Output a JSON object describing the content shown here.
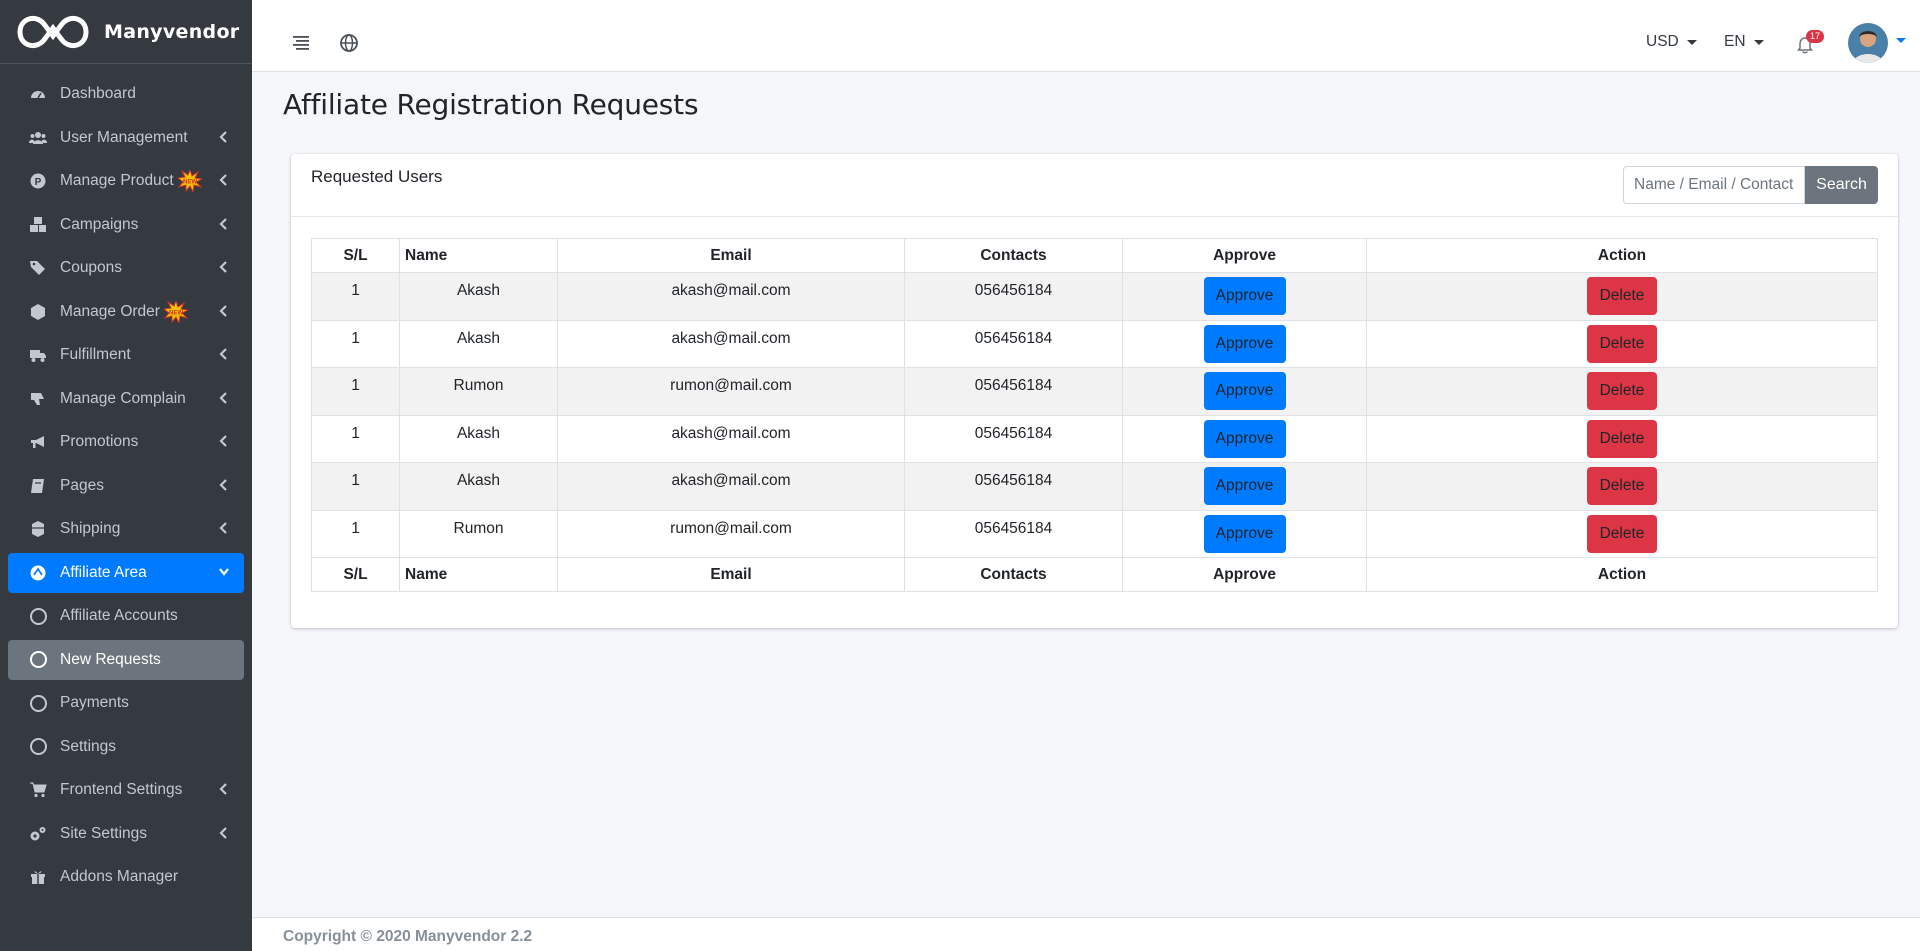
{
  "brand": {
    "name": "Manyvendor"
  },
  "sidebar": {
    "items": [
      {
        "label": "Dashboard",
        "icon": "dashboard-icon",
        "has_chevron": false
      },
      {
        "label": "User Management",
        "icon": "users-icon",
        "has_chevron": true
      },
      {
        "label": "Manage Product",
        "icon": "product-icon",
        "has_chevron": true,
        "new_badge": true
      },
      {
        "label": "Campaigns",
        "icon": "cubes-icon",
        "has_chevron": true
      },
      {
        "label": "Coupons",
        "icon": "tags-icon",
        "has_chevron": true
      },
      {
        "label": "Manage Order",
        "icon": "box-icon",
        "has_chevron": true,
        "new_badge": true
      },
      {
        "label": "Fulfillment",
        "icon": "truck-icon",
        "has_chevron": true
      },
      {
        "label": "Manage Complain",
        "icon": "thumbs-down-icon",
        "has_chevron": true
      },
      {
        "label": "Promotions",
        "icon": "bullhorn-icon",
        "has_chevron": true
      },
      {
        "label": "Pages",
        "icon": "book-icon",
        "has_chevron": true
      },
      {
        "label": "Shipping",
        "icon": "shipping-icon",
        "has_chevron": true
      },
      {
        "label": "Affiliate Area",
        "icon": "affiliate-icon",
        "has_chevron": true,
        "active": true
      },
      {
        "label": "Affiliate Accounts",
        "icon": "circle-icon",
        "sub": true
      },
      {
        "label": "New Requests",
        "icon": "circle-icon",
        "sub": true,
        "selected": true
      },
      {
        "label": "Payments",
        "icon": "circle-icon",
        "sub": true
      },
      {
        "label": "Settings",
        "icon": "circle-icon",
        "sub": true
      },
      {
        "label": "Frontend Settings",
        "icon": "cart-icon",
        "has_chevron": true
      },
      {
        "label": "Site Settings",
        "icon": "cogs-icon",
        "has_chevron": true
      },
      {
        "label": "Addons Manager",
        "icon": "gift-icon",
        "has_chevron": false
      }
    ]
  },
  "topbar": {
    "currency": "USD",
    "language": "EN",
    "notification_count": "17"
  },
  "page": {
    "title": "Affiliate Registration Requests"
  },
  "card": {
    "title": "Requested Users",
    "search_placeholder": "Name / Email / Contact",
    "search_button": "Search"
  },
  "table": {
    "headers": [
      "S/L",
      "Name",
      "Email",
      "Contacts",
      "Approve",
      "Action"
    ],
    "rows": [
      {
        "sl": "1",
        "name": "Akash",
        "email": "akash@mail.com",
        "contact": "056456184",
        "approve": "Approve",
        "action": "Delete"
      },
      {
        "sl": "1",
        "name": "Akash",
        "email": "akash@mail.com",
        "contact": "056456184",
        "approve": "Approve",
        "action": "Delete"
      },
      {
        "sl": "1",
        "name": "Rumon",
        "email": "rumon@mail.com",
        "contact": "056456184",
        "approve": "Approve",
        "action": "Delete"
      },
      {
        "sl": "1",
        "name": "Akash",
        "email": "akash@mail.com",
        "contact": "056456184",
        "approve": "Approve",
        "action": "Delete"
      },
      {
        "sl": "1",
        "name": "Akash",
        "email": "akash@mail.com",
        "contact": "056456184",
        "approve": "Approve",
        "action": "Delete"
      },
      {
        "sl": "1",
        "name": "Rumon",
        "email": "rumon@mail.com",
        "contact": "056456184",
        "approve": "Approve",
        "action": "Delete"
      }
    ]
  },
  "footer": {
    "text": "Copyright © 2020 Manyvendor 2.2"
  },
  "colors": {
    "sidebar_bg": "#343a40",
    "active": "#007bff",
    "selected": "#6c757d",
    "danger": "#dc3545"
  }
}
